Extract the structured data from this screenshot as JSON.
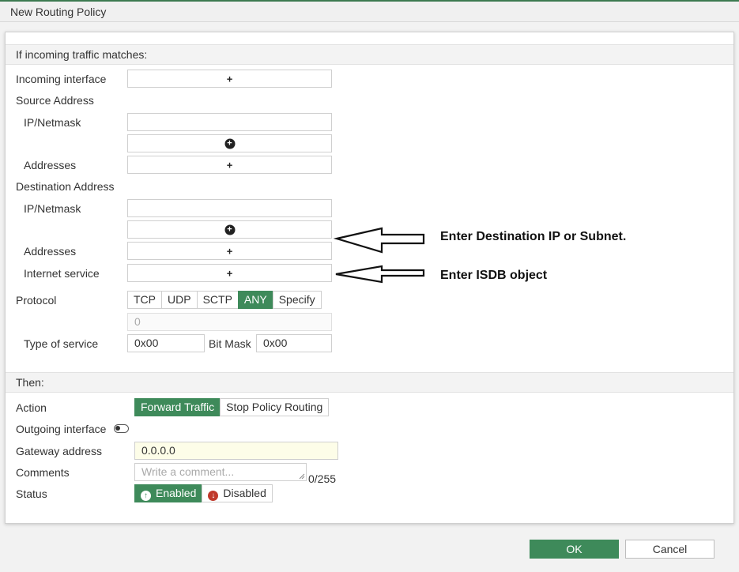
{
  "window": {
    "title": "New Routing Policy"
  },
  "match": {
    "header": "If incoming traffic matches:",
    "incoming_interface_label": "Incoming interface",
    "source_address_label": "Source Address",
    "source_ipnetmask_label": "IP/Netmask",
    "source_addresses_label": "Addresses",
    "destination_address_label": "Destination Address",
    "destination_ipnetmask_label": "IP/Netmask",
    "destination_addresses_label": "Addresses",
    "internet_service_label": "Internet service",
    "add_symbol": "+",
    "add_circle_symbol": "+"
  },
  "protocol": {
    "label": "Protocol",
    "options": [
      "TCP",
      "UDP",
      "SCTP",
      "ANY",
      "Specify"
    ],
    "selected": "ANY",
    "number_placeholder": "0"
  },
  "tos": {
    "label": "Type of service",
    "value": "0x00",
    "bitmask_label": "Bit Mask",
    "bitmask_value": "0x00"
  },
  "then": {
    "header": "Then:",
    "action_label": "Action",
    "action_options": [
      "Forward Traffic",
      "Stop Policy Routing"
    ],
    "action_selected": "Forward Traffic",
    "outgoing_interface_label": "Outgoing interface",
    "gateway_label": "Gateway address",
    "gateway_value": "0.0.0.0",
    "comments_label": "Comments",
    "comments_placeholder": "Write a comment...",
    "comments_counter": "0/255",
    "status_label": "Status",
    "status_enabled": "Enabled",
    "status_disabled": "Disabled",
    "status_selected": "Enabled"
  },
  "annotations": {
    "destination_note": "Enter Destination IP or Subnet.",
    "isdb_note": "Enter ISDB object"
  },
  "footer": {
    "ok_label": "OK",
    "cancel_label": "Cancel"
  },
  "colors": {
    "accent": "#3e8a5a",
    "disabled_red": "#c0392b",
    "gateway_bg": "#fdfde8"
  },
  "icons": {
    "add": "plus-icon",
    "add_circle": "plus-circle-icon",
    "toggle": "toggle-off-icon",
    "enabled": "arrow-up-circle-icon",
    "disabled": "arrow-down-circle-icon",
    "arrow": "left-arrow-annotation"
  }
}
